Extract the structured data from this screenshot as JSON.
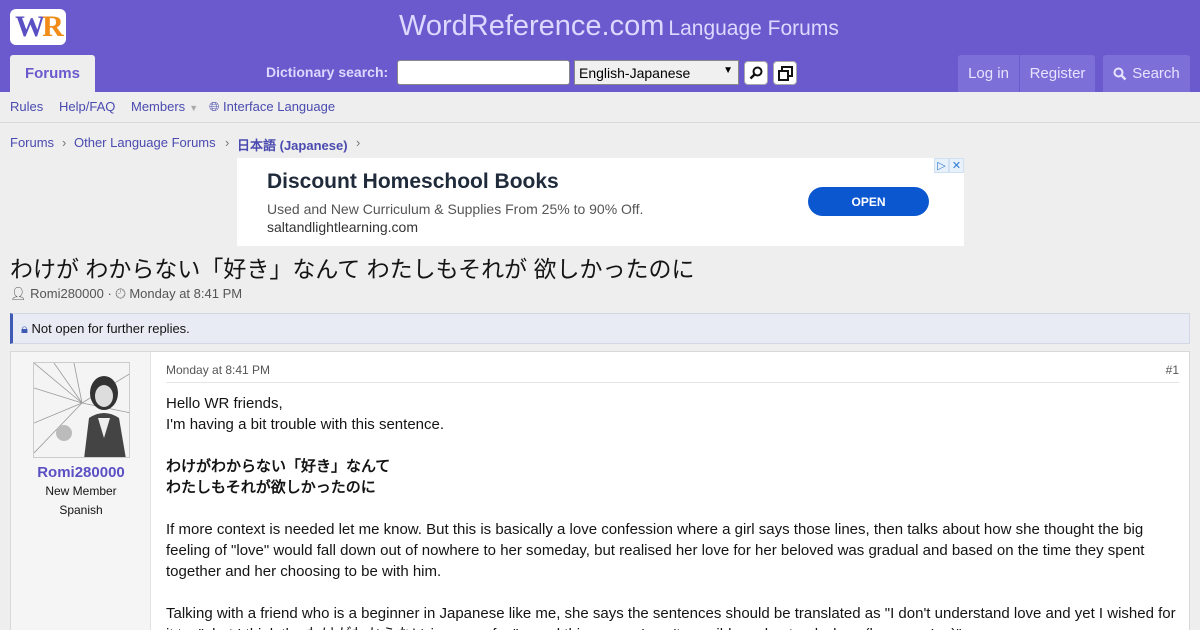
{
  "header": {
    "logo_w": "W",
    "logo_r": "R",
    "site_title": "WordReference.com",
    "site_subtitle": "Language Forums",
    "forums_tab": "Forums",
    "dict_label": "Dictionary search:",
    "dict_value": "",
    "dict_select": "English-Japanese",
    "login": "Log in",
    "register": "Register",
    "search": "Search"
  },
  "subnav": {
    "rules": "Rules",
    "help": "Help/FAQ",
    "members": "Members",
    "interface_language": "Interface Language"
  },
  "breadcrumb": [
    "Forums",
    "Other Language Forums",
    "日本語 (Japanese)"
  ],
  "ad": {
    "title": "Discount Homeschool Books",
    "desc": "Used and New Curriculum & Supplies From 25% to 90% Off.",
    "url": "saltandlightlearning.com",
    "cta": "OPEN"
  },
  "thread": {
    "title": "わけが わからない「好き」なんて わたしもそれが 欲しかったのに",
    "author": "Romi280000",
    "date": "Monday at 8:41 PM",
    "notice": "Not open for further replies."
  },
  "post": {
    "username": "Romi280000",
    "rank": "New Member",
    "language": "Spanish",
    "date": "Monday at 8:41 PM",
    "number": "#1",
    "line1": "Hello WR friends,",
    "line2": "I'm having a bit trouble with this sentence.",
    "quote1": "わけがわからない「好き」なんて",
    "quote2": "わたしもそれが欲しかったのに",
    "para1": "If more context is needed let me know. But this is basically a love confession where a girl says those lines, then talks about how she thought the big feeling of \"love\" would fall down out of nowhere to her someday, but realised her love for her beloved was gradual and based on the time they spent together and her choosing to be with him.",
    "para2": "Talking with a friend who is a beginner in Japanese like me, she says the sentences should be translated as \"I don't understand love and yet I wished for it too\", but I think the わけがわからない is more of a \"... and this means I can't possibly understand why... (because I ...)\"."
  }
}
